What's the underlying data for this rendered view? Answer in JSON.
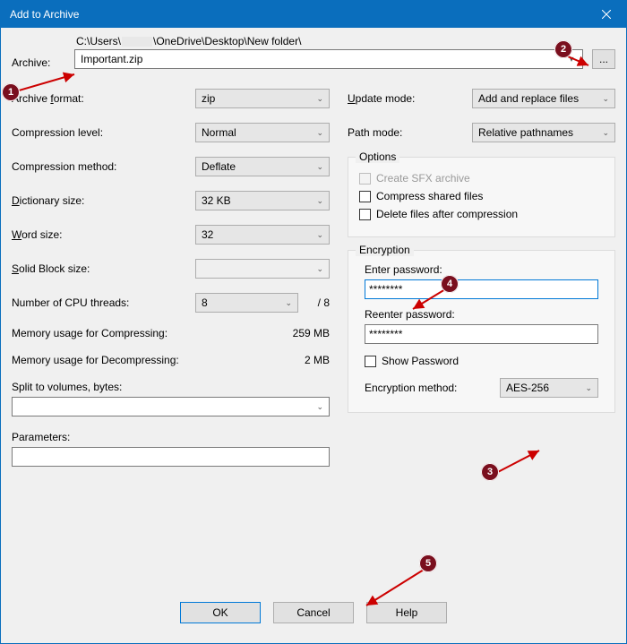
{
  "window": {
    "title": "Add to Archive"
  },
  "archive": {
    "label": "Archive:",
    "path_prefix": "C:\\Users\\",
    "path_suffix": "\\OneDrive\\Desktop\\New folder\\",
    "filename": "Important.zip",
    "browse": "..."
  },
  "left": {
    "format_label_pre": "Archive ",
    "format_label_mn": "f",
    "format_label_post": "ormat:",
    "format_value": "zip",
    "level_label": "Compression level:",
    "level_value": "Normal",
    "method_label": "Compression method:",
    "method_value": "Deflate",
    "dict_label_mn": "D",
    "dict_label_post": "ictionary size:",
    "dict_value": "32 KB",
    "word_label_mn": "W",
    "word_label_post": "ord size:",
    "word_value": "32",
    "solid_label_mn": "S",
    "solid_label_post": "olid Block size:",
    "solid_value": "",
    "cpu_label": "Number of CPU threads:",
    "cpu_value": "8",
    "cpu_total": "/ 8",
    "mem_comp_label": "Memory usage for Compressing:",
    "mem_comp_value": "259 MB",
    "mem_decomp_label": "Memory usage for Decompressing:",
    "mem_decomp_value": "2 MB",
    "split_label": "Split to volumes, bytes:",
    "params_label": "Parameters:"
  },
  "right": {
    "update_label_mn": "U",
    "update_label_post": "pdate mode:",
    "update_value": "Add and replace files",
    "path_label": "Path mode:",
    "path_value": "Relative pathnames",
    "options_title": "Options",
    "opt_sfx": "Create SFX archive",
    "opt_shared": "Compress shared files",
    "opt_delete": "Delete files after compression",
    "enc_title": "Encryption",
    "enter_pw": "Enter password:",
    "reenter_pw": "Reenter password:",
    "pw_value": "********",
    "pw_value2": "********",
    "show_pw": "Show Password",
    "enc_method_label": "Encryption method:",
    "enc_method_value": "AES-256"
  },
  "buttons": {
    "ok": "OK",
    "cancel": "Cancel",
    "help": "Help"
  },
  "annotations": {
    "n1": "1",
    "n2": "2",
    "n3": "3",
    "n4": "4",
    "n5": "5"
  }
}
